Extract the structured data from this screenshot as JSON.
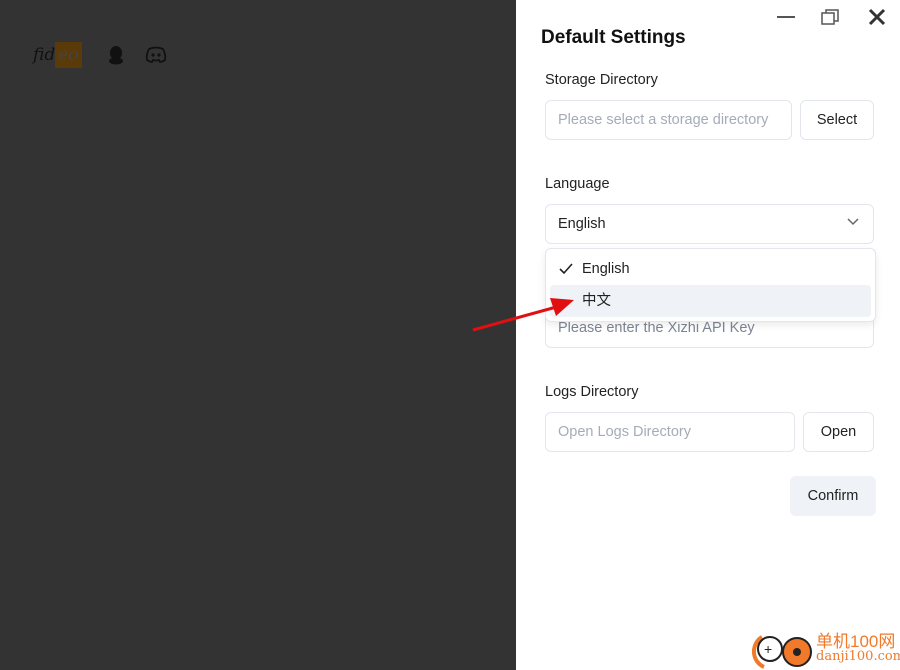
{
  "background": {
    "logo": "fideo",
    "logo_parts": [
      "fid",
      "eo"
    ]
  },
  "window": {
    "minimize": "minimize",
    "restore": "restore",
    "close": "close"
  },
  "dialog": {
    "title": "Default Settings",
    "storage": {
      "label": "Storage Directory",
      "placeholder": "Please select a storage directory",
      "button": "Select"
    },
    "language": {
      "label": "Language",
      "value": "English",
      "options": [
        {
          "label": "English",
          "selected": true
        },
        {
          "label": "中文",
          "selected": false,
          "highlighted": true
        }
      ]
    },
    "api_key": {
      "placeholder": "Please enter the Xizhi API Key"
    },
    "logs": {
      "label": "Logs Directory",
      "placeholder": "Open Logs Directory",
      "button": "Open"
    },
    "confirm": "Confirm"
  },
  "watermark": {
    "line1": "单机100网",
    "line2": "danji100.com"
  },
  "colors": {
    "overlay": "#333333",
    "arrow": "#e01010",
    "watermark": "#f07a2a"
  }
}
